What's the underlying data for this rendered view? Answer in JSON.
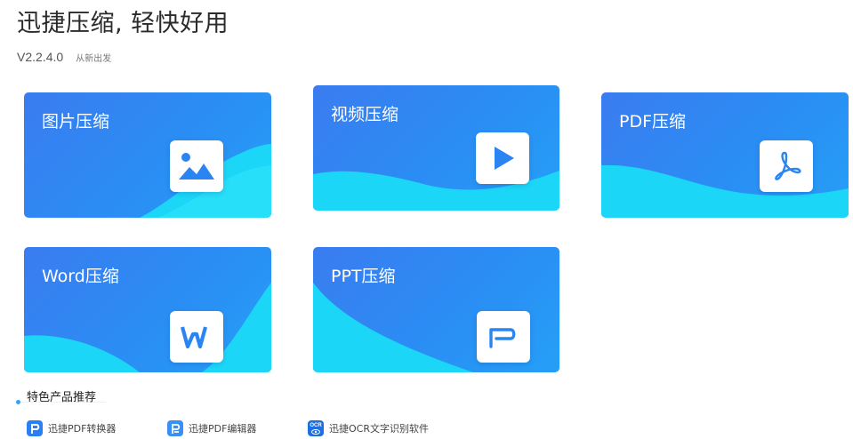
{
  "header": {
    "title": "迅捷压缩, 轻快好用",
    "version": "V2.2.4.0",
    "version_note": "从新出发"
  },
  "cards": [
    {
      "label": "图片压缩",
      "icon": "image-icon"
    },
    {
      "label": "视频压缩",
      "icon": "play-icon"
    },
    {
      "label": "PDF压缩",
      "icon": "acrobat-icon"
    },
    {
      "label": "Word压缩",
      "icon": "word-icon"
    },
    {
      "label": "PPT压缩",
      "icon": "ppt-icon"
    }
  ],
  "featured": {
    "title": "特色产品推荐",
    "products": [
      {
        "name": "迅捷PDF转换器",
        "icon": "pdf-converter-icon"
      },
      {
        "name": "迅捷PDF编辑器",
        "icon": "pdf-editor-icon"
      },
      {
        "name": "迅捷OCR文字识别软件",
        "icon": "ocr-icon",
        "icon_text": "OCR"
      }
    ]
  },
  "colors": {
    "card_primary": "#3b7cf0",
    "card_wave": "#1fe0f8",
    "accent": "#3aa0f5"
  }
}
